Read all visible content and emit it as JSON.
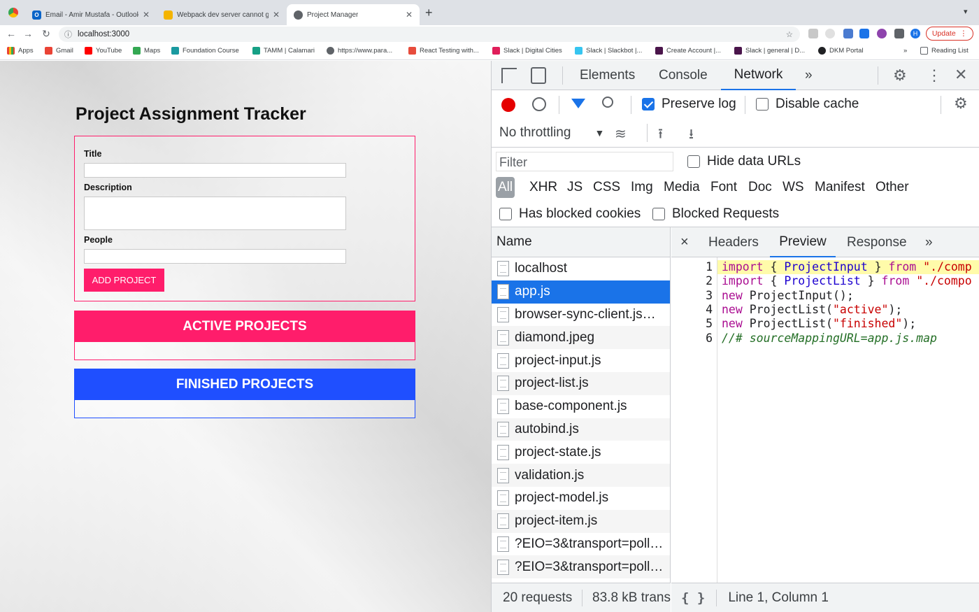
{
  "browser": {
    "tabs": [
      {
        "title": "Email - Amir Mustafa - Outlook",
        "icon": "outlook-icon"
      },
      {
        "title": "Webpack dev server cannot ge",
        "icon": "webpack-icon"
      },
      {
        "title": "Project Manager",
        "icon": "globe-icon",
        "active": true
      }
    ],
    "new_tab": "+",
    "url": "localhost:3000",
    "update_label": "Update",
    "profile_initial": "H",
    "bookmarks": [
      {
        "label": "Apps",
        "icon": "apps-grid-icon"
      },
      {
        "label": "Gmail",
        "icon": "gmail-icon"
      },
      {
        "label": "YouTube",
        "icon": "youtube-icon"
      },
      {
        "label": "Maps",
        "icon": "maps-icon"
      },
      {
        "label": "Foundation Course",
        "icon": "bookmark-icon"
      },
      {
        "label": "TAMM | Calamari",
        "icon": "bookmark-icon"
      },
      {
        "label": "https://www.para...",
        "icon": "globe-icon"
      },
      {
        "label": "React Testing with...",
        "icon": "bookmark-icon"
      },
      {
        "label": "Slack | Digital Cities",
        "icon": "slack-icon"
      },
      {
        "label": "Slack | Slackbot |...",
        "icon": "slack-icon"
      },
      {
        "label": "Create Account |...",
        "icon": "bookmark-icon"
      },
      {
        "label": "Slack | general | D...",
        "icon": "slack-icon"
      },
      {
        "label": "DKM Portal",
        "icon": "globe-icon"
      }
    ],
    "more_bookmarks": "»",
    "reading_list": "Reading List"
  },
  "app": {
    "title": "Project Assignment Tracker",
    "form": {
      "title_label": "Title",
      "description_label": "Description",
      "people_label": "People",
      "add_button": "ADD PROJECT"
    },
    "active_header": "ACTIVE PROJECTS",
    "finished_header": "FINISHED PROJECTS",
    "colors": {
      "accent": "#ff1d6b",
      "finished": "#1f4fff"
    }
  },
  "devtools": {
    "tabs": [
      "Elements",
      "Console",
      "Network"
    ],
    "active_tab": "Network",
    "more": "»",
    "preserve_log": "Preserve log",
    "preserve_log_checked": true,
    "disable_cache": "Disable cache",
    "disable_cache_checked": false,
    "throttling": "No throttling",
    "filter_placeholder": "Filter",
    "hide_data_urls": "Hide data URLs",
    "types": [
      "All",
      "XHR",
      "JS",
      "CSS",
      "Img",
      "Media",
      "Font",
      "Doc",
      "WS",
      "Manifest",
      "Other"
    ],
    "has_blocked_cookies": "Has blocked cookies",
    "blocked_requests": "Blocked Requests",
    "name_header": "Name",
    "requests": [
      "localhost",
      "app.js",
      "browser-sync-client.js…",
      "diamond.jpeg",
      "project-input.js",
      "project-list.js",
      "base-component.js",
      "autobind.js",
      "project-state.js",
      "validation.js",
      "project-model.js",
      "project-item.js",
      "?EIO=3&transport=poll…",
      "?EIO=3&transport=poll…"
    ],
    "selected_request": "app.js",
    "summary_requests": "20 requests",
    "summary_transfer": "83.8 kB trans",
    "preview_tabs": [
      "Headers",
      "Preview",
      "Response"
    ],
    "active_preview_tab": "Preview",
    "close": "×",
    "code_lines": [
      [
        "import",
        " { ",
        "ProjectInput",
        " } ",
        "from",
        " \"./comp"
      ],
      [
        "import",
        " { ",
        "ProjectList",
        " } ",
        "from",
        " \"./compo"
      ],
      [
        "new",
        " ProjectInput();"
      ],
      [
        "new",
        " ProjectList(",
        "\"active\"",
        ");"
      ],
      [
        "new",
        " ProjectList(",
        "\"finished\"",
        ");"
      ],
      [
        "//# sourceMappingURL=app.js.map"
      ]
    ],
    "line_numbers": [
      "1",
      "2",
      "3",
      "4",
      "5",
      "6"
    ],
    "pretty_print": "{ }",
    "cursor_position": "Line 1, Column 1"
  }
}
